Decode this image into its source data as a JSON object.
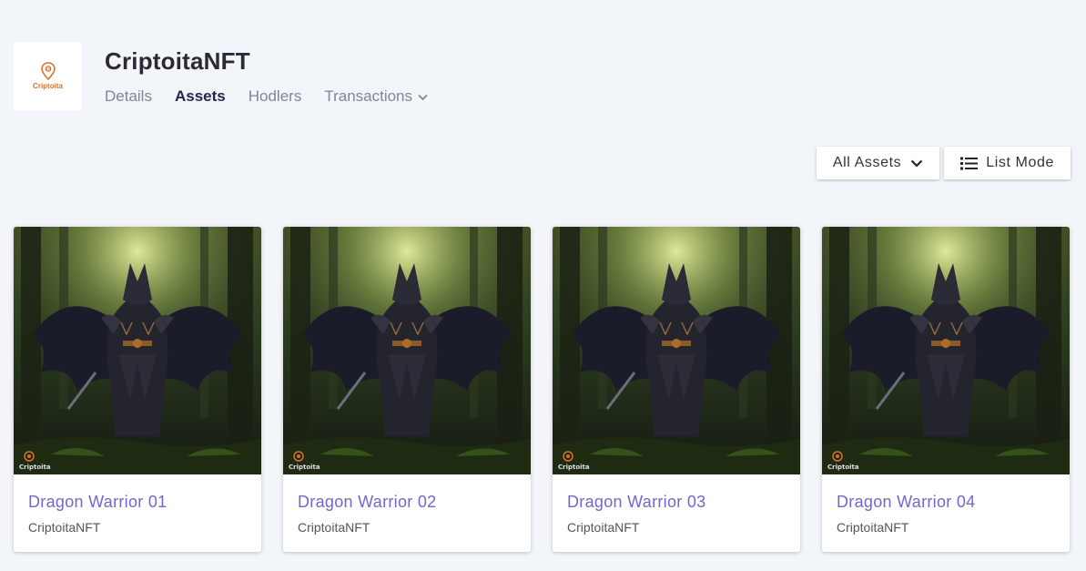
{
  "collection": {
    "logo_text": "Criptoita",
    "name": "CriptoitaNFT"
  },
  "tabs": [
    {
      "label": "Details",
      "active": false
    },
    {
      "label": "Assets",
      "active": true
    },
    {
      "label": "Hodlers",
      "active": false
    },
    {
      "label": "Transactions",
      "active": false,
      "has_dropdown": true
    }
  ],
  "controls": {
    "filter_label": "All Assets",
    "view_label": "List Mode"
  },
  "assets": [
    {
      "title": "Dragon Warrior 01",
      "collection": "CriptoitaNFT",
      "watermark": "Criptoita"
    },
    {
      "title": "Dragon Warrior 02",
      "collection": "CriptoitaNFT",
      "watermark": "Criptoita"
    },
    {
      "title": "Dragon Warrior 03",
      "collection": "CriptoitaNFT",
      "watermark": "Criptoita"
    },
    {
      "title": "Dragon Warrior 04",
      "collection": "CriptoitaNFT",
      "watermark": "Criptoita"
    }
  ],
  "colors": {
    "background": "#f2f5f9",
    "accent_brand": "#d9712a",
    "asset_title": "#7566cc",
    "active_tab": "#23284a"
  }
}
